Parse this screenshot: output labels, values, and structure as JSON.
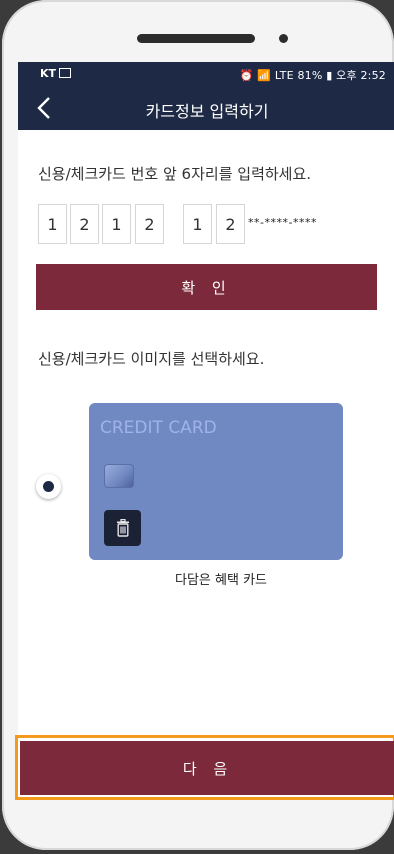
{
  "status_bar": {
    "carrier": "KT",
    "right": "⏰ 📶 LTE 81% ▮ 오후 2:52"
  },
  "header": {
    "title": "카드정보 입력하기"
  },
  "card_number": {
    "instruction": "신용/체크카드 번호 앞 6자리를 입력하세요.",
    "digits": [
      "1",
      "2",
      "1",
      "2",
      "1",
      "2"
    ],
    "separator": "-",
    "masked": "**-****-****"
  },
  "confirm_button": "확 인",
  "card_image": {
    "instruction": "신용/체크카드 이미지를 선택하세요.",
    "card_label": "CREDIT CARD",
    "card_name": "다담은 혜택 카드",
    "selected": true
  },
  "next_button": "다 음",
  "colors": {
    "navy": "#1e2a45",
    "maroon": "#7c2a3b",
    "card_blue": "#7189c3",
    "highlight": "#f39a1d"
  }
}
